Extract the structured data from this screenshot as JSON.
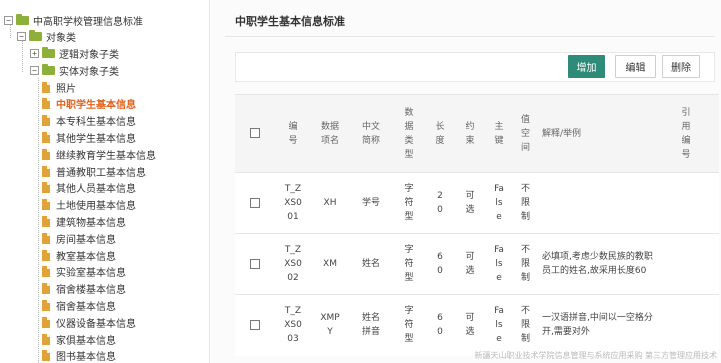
{
  "tree": {
    "root": "中高职学校管理信息标准",
    "group": "对象类",
    "logical": "逻辑对象子类",
    "entity": "实体对象子类",
    "items": [
      "照片",
      "中职学生基本信息",
      "本专科生基本信息",
      "其他学生基本信息",
      "继续教育学生基本信息",
      "普通教职工基本信息",
      "其他人员基本信息",
      "土地使用基本信息",
      "建筑物基本信息",
      "房间基本信息",
      "教室基本信息",
      "实验室基本信息",
      "宿舍楼基本信息",
      "宿舍基本信息",
      "仪器设备基本信息",
      "家俱基本信息",
      "图书基本信息"
    ],
    "active_index": 1,
    "expand_sign": "+",
    "collapse_sign": "−"
  },
  "main": {
    "title": "中职学生基本信息标准",
    "buttons": {
      "add": "增加",
      "edit": "编辑",
      "delete": "删除"
    },
    "columns": [
      "编号",
      "数据项名",
      "中文简称",
      "数据类型",
      "长度",
      "约束",
      "主键",
      "值空间",
      "解释/举例",
      "引用编号"
    ],
    "rows": [
      [
        "T_ZXS001",
        "XH",
        "学号",
        "字符型",
        "20",
        "可选",
        "False",
        "不限制",
        "",
        ""
      ],
      [
        "T_ZXS002",
        "XM",
        "姓名",
        "字符型",
        "60",
        "可选",
        "False",
        "不限制",
        "必填项,考虑少数民族的教职员工的姓名,故采用长度60",
        ""
      ],
      [
        "T_ZXS003",
        "XMPY",
        "姓名拼音",
        "字符型",
        "60",
        "可选",
        "False",
        "不限制",
        "一汉语拼音,中间以一空格分开,需要对外",
        ""
      ]
    ]
  },
  "watermark": "新疆天山职业技术学院信息管理与系统应用采购 第三方管理应用技术"
}
